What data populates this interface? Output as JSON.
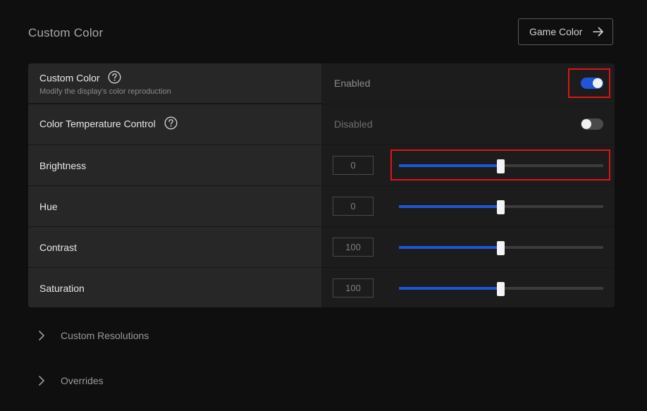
{
  "header": {
    "title": "Custom Color",
    "game_color_label": "Game Color"
  },
  "rows": [
    {
      "label": "Custom Color",
      "subtitle": "Modify the display's color reproduction",
      "status": "Enabled",
      "toggle": "on"
    },
    {
      "label": "Color Temperature Control",
      "status": "Disabled",
      "toggle": "off"
    },
    {
      "label": "Brightness",
      "value": "0",
      "level": 0.5
    },
    {
      "label": "Hue",
      "value": "0",
      "level": 0.5
    },
    {
      "label": "Contrast",
      "value": "100",
      "level": 0.5
    },
    {
      "label": "Saturation",
      "value": "100",
      "level": 0.5
    }
  ],
  "expanders": [
    {
      "label": "Custom Resolutions"
    },
    {
      "label": "Overrides"
    }
  ],
  "colors": {
    "accent": "#1e56d6",
    "highlight": "#e0121a"
  },
  "icons": {
    "help": "question-circle-icon",
    "arrow": "arrow-right-icon",
    "chevron": "chevron-right-icon"
  }
}
